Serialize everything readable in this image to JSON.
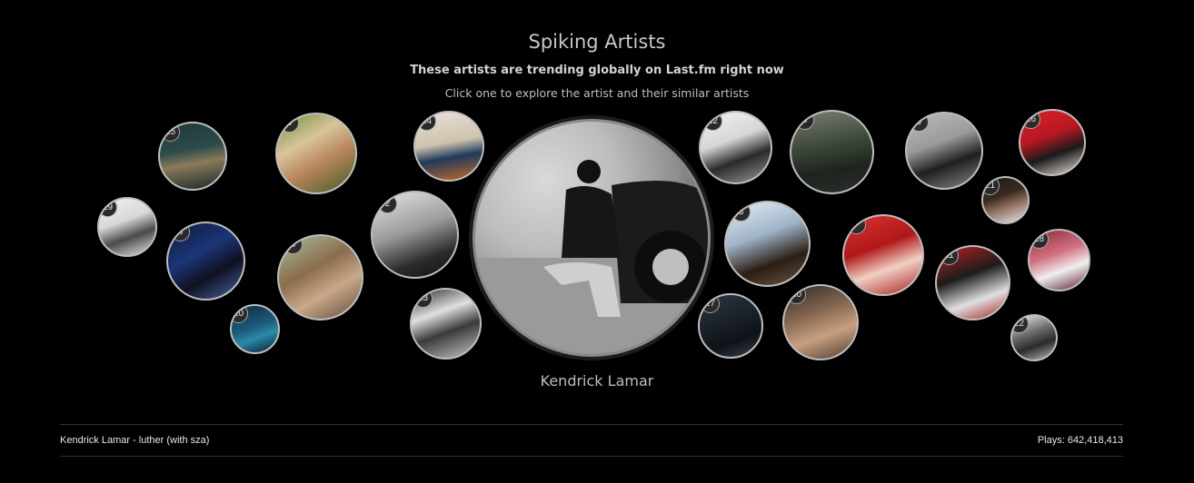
{
  "header": {
    "title": "Spiking Artists",
    "subtitle": "These artists are trending globally on Last.fm right now",
    "hint": "Click one to explore the artist and their similar artists"
  },
  "featured": {
    "name": "Kendrick Lamar"
  },
  "artists": [
    {
      "rank": "2"
    },
    {
      "rank": "3"
    },
    {
      "rank": "4"
    },
    {
      "rank": "5"
    },
    {
      "rank": "6"
    },
    {
      "rank": "7"
    },
    {
      "rank": "8"
    },
    {
      "rank": "9"
    },
    {
      "rank": "10"
    },
    {
      "rank": "11"
    },
    {
      "rank": "12"
    },
    {
      "rank": "13"
    },
    {
      "rank": "14"
    },
    {
      "rank": "15"
    },
    {
      "rank": "16"
    },
    {
      "rank": "17"
    },
    {
      "rank": "18"
    },
    {
      "rank": "19"
    },
    {
      "rank": "20"
    },
    {
      "rank": "21"
    },
    {
      "rank": "22"
    }
  ],
  "footer": {
    "track": "Kendrick Lamar - luther (with sza)",
    "plays": "Plays: 642,418,413"
  },
  "colors": {
    "background": "#000000",
    "bubble_border": "#bdbdbd",
    "badge_bg": "#2a2a2a"
  }
}
